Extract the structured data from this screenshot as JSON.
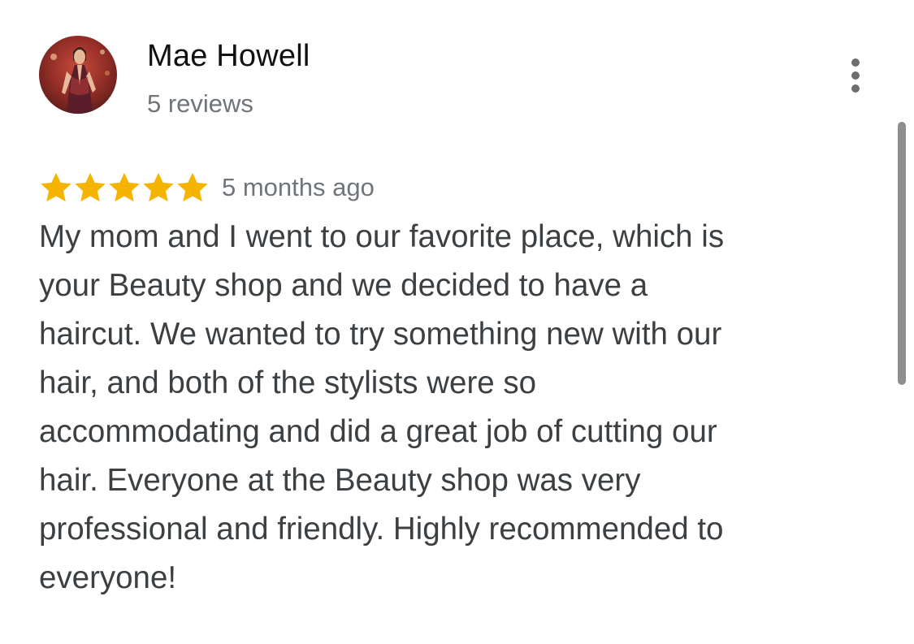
{
  "reviewer": {
    "name": "Mae Howell",
    "reviews_count": "5 reviews",
    "avatar_icon": "person-photo-avatar"
  },
  "rating": {
    "stars": 5,
    "max_stars": 5,
    "star_icon": "star-icon",
    "star_color": "#f4b400",
    "date": "5 months ago"
  },
  "review": {
    "text": "My mom and I went to our favorite place, which is\nyour Beauty shop and we decided to have a\nhaircut. We wanted to try something new with our\nhair, and both of the stylists were so\naccommodating and did a great job of cutting our\nhair. Everyone at the Beauty shop was very\nprofessional and friendly. Highly recommended to\neveryone!"
  },
  "actions": {
    "more_icon": "more-vertical-icon"
  },
  "colors": {
    "name": "#111111",
    "meta": "#70757a",
    "body_text": "#3c4043",
    "scrollbar": "#8e8e8e",
    "menu_dots": "#6e6e6e"
  }
}
